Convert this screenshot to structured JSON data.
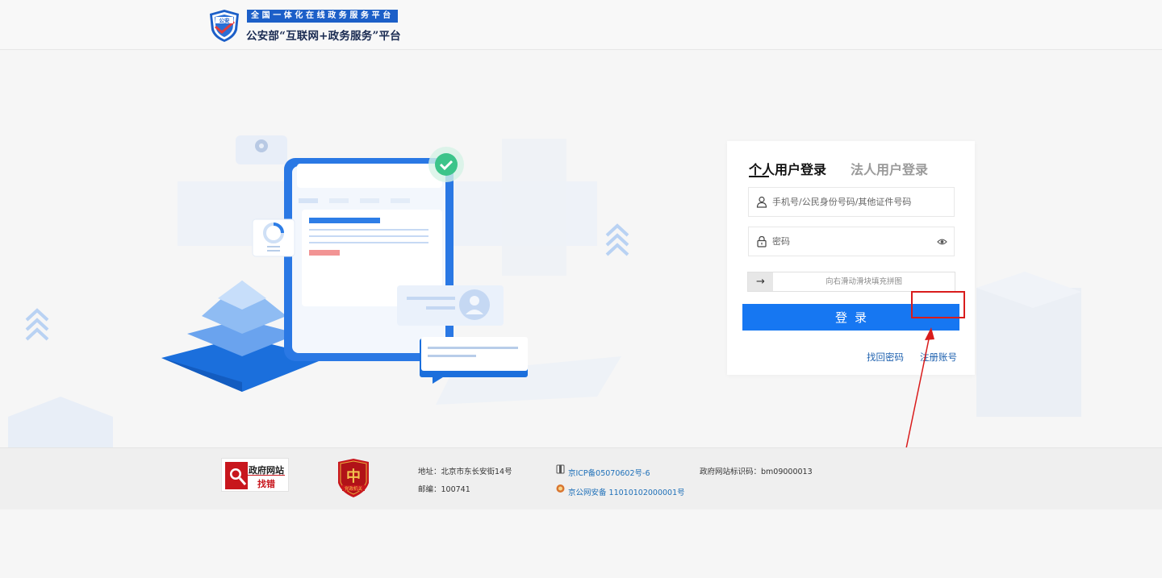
{
  "header": {
    "banner_text": "全国一体化在线政务服务平台",
    "title": "公安部“互联网+政务服务”平台",
    "emblem_text": "公安"
  },
  "login": {
    "tabs": [
      {
        "label": "个人用户登录",
        "active": true
      },
      {
        "label": "法人用户登录",
        "active": false
      }
    ],
    "username_placeholder": "手机号/公民身份号码/其他证件号码",
    "password_placeholder": "密码",
    "slider_handle": "→",
    "slider_text": "向右滑动滑块填充拼图",
    "submit_label": "登录",
    "forgot_label": "找回密码",
    "register_label": "注册账号"
  },
  "footer": {
    "jiucuo_line1": "政府网站",
    "jiucuo_line2": "找错",
    "dangzheng_text": "党政机关",
    "address": "地址：北京市东长安街14号",
    "postcode": "邮编：100741",
    "icp": "京ICP备05070602号-6",
    "police_record": "京公网安备 11010102000001号",
    "site_id": "政府网站标识码：bm09000013"
  },
  "colors": {
    "primary": "#1677f2",
    "banner": "#1c5fc8",
    "highlight": "#d91c1c",
    "link": "#2163b0"
  }
}
